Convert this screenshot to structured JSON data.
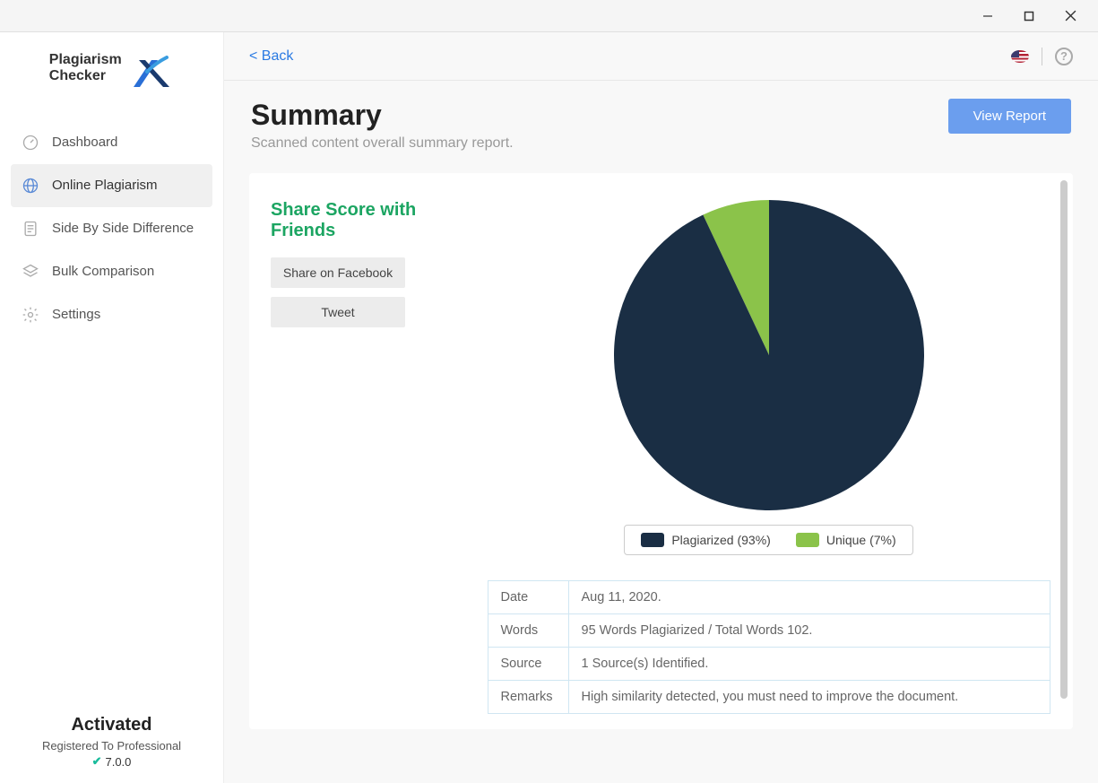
{
  "app_name_line1": "Plagiarism",
  "app_name_line2": "Checker",
  "sidebar": {
    "items": [
      {
        "label": "Dashboard"
      },
      {
        "label": "Online Plagiarism"
      },
      {
        "label": "Side By Side Difference"
      },
      {
        "label": "Bulk Comparison"
      },
      {
        "label": "Settings"
      }
    ],
    "activated": "Activated",
    "registered": "Registered To Professional",
    "version": "7.0.0"
  },
  "topbar": {
    "back": "< Back"
  },
  "header": {
    "title": "Summary",
    "subtitle": "Scanned content overall summary report.",
    "view_report": "View Report"
  },
  "share": {
    "title": "Share Score with Friends",
    "facebook": "Share on Facebook",
    "tweet": "Tweet"
  },
  "legend": {
    "plagiarized": "Plagiarized (93%)",
    "unique": "Unique (7%)"
  },
  "details": {
    "date_label": "Date",
    "date_value": "Aug 11, 2020.",
    "words_label": "Words",
    "words_value": "95 Words Plagiarized / Total Words 102.",
    "source_label": "Source",
    "source_value": "1 Source(s) Identified.",
    "remarks_label": "Remarks",
    "remarks_value": "High similarity detected, you must need to improve the document."
  },
  "chart_data": {
    "type": "pie",
    "title": "",
    "series": [
      {
        "name": "Plagiarized",
        "value": 93,
        "color": "#1a2e44"
      },
      {
        "name": "Unique",
        "value": 7,
        "color": "#8bc34a"
      }
    ]
  }
}
